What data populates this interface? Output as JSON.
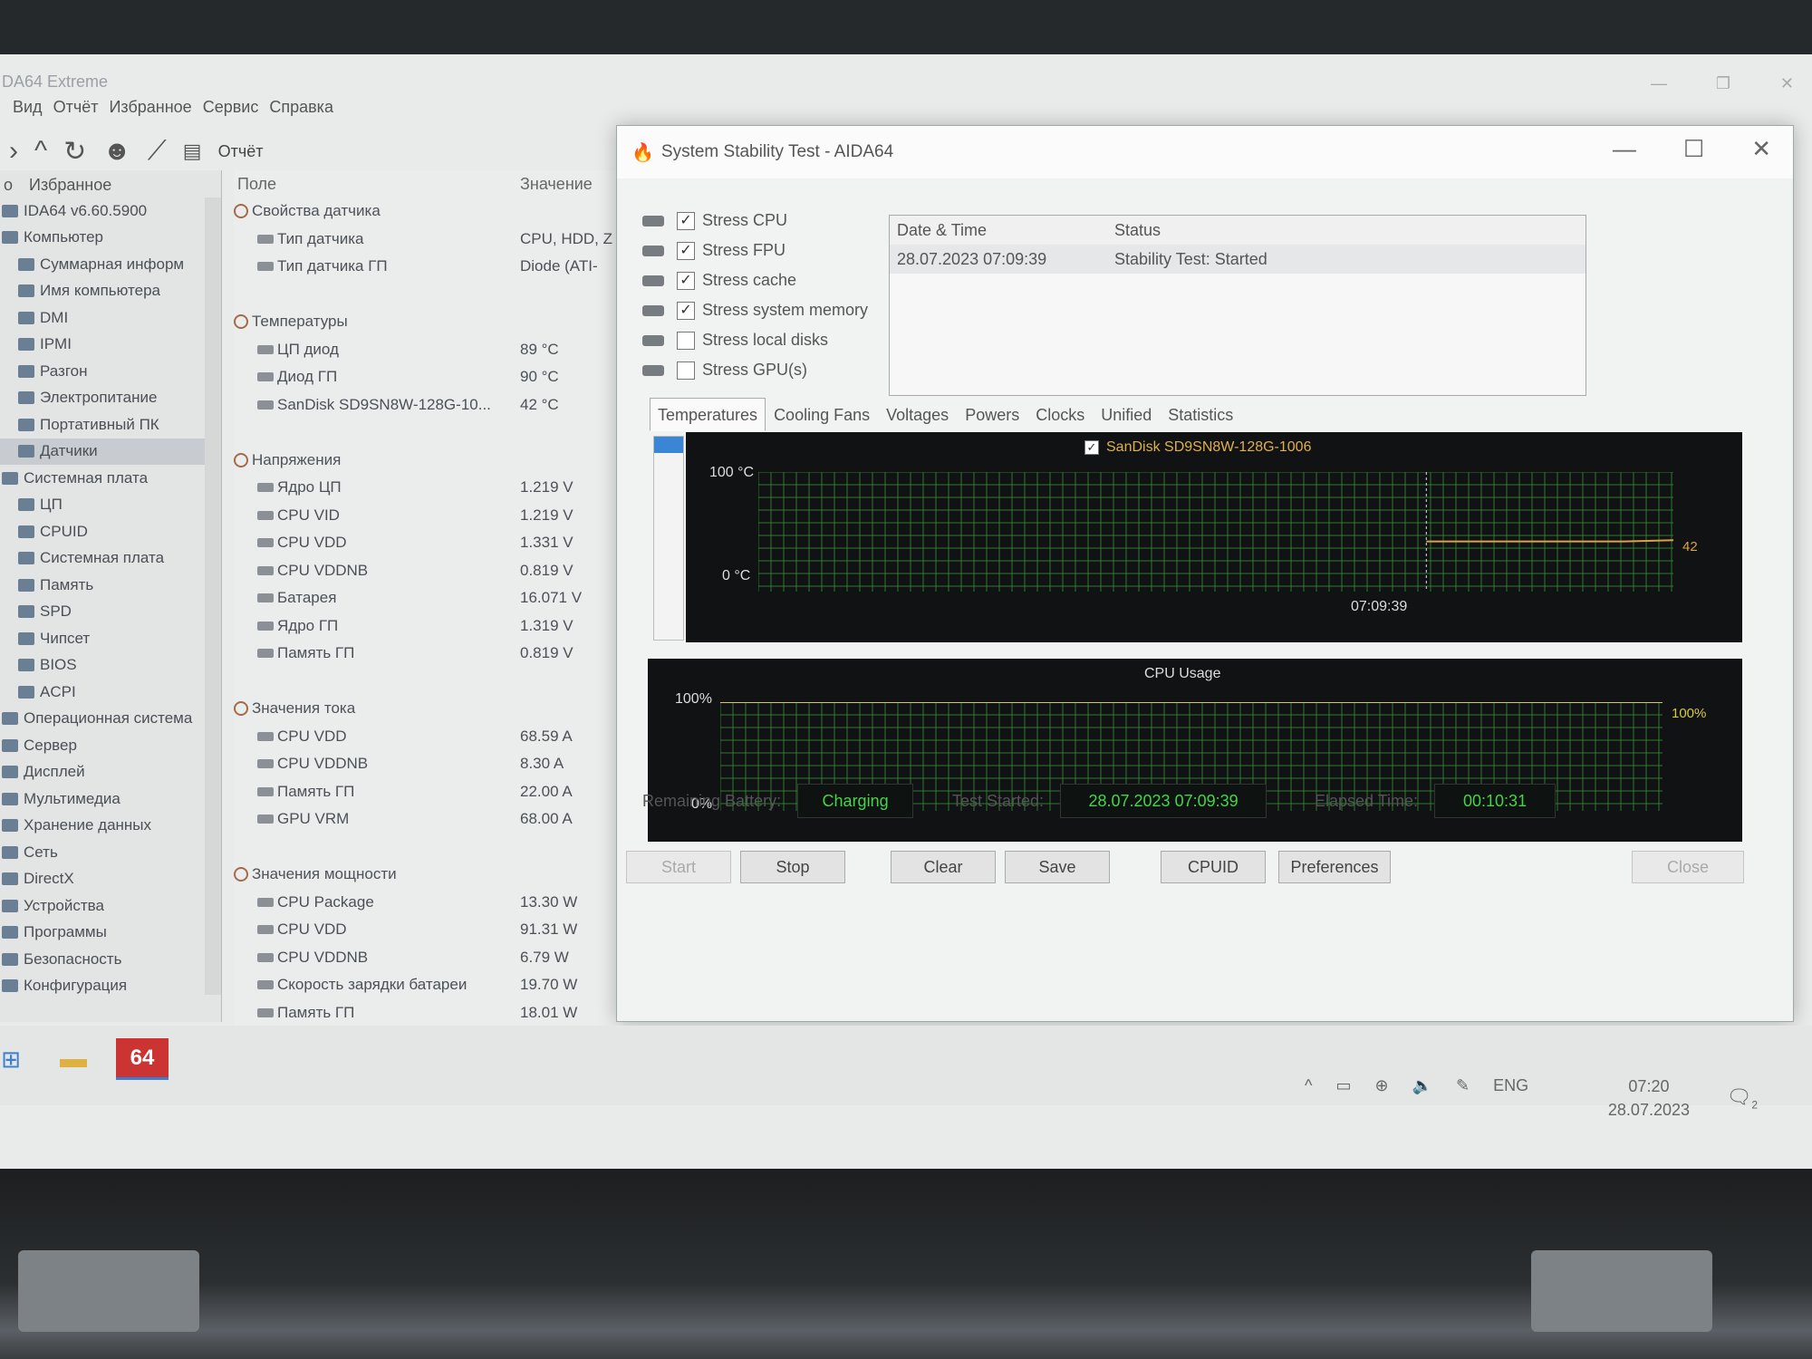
{
  "main": {
    "title": "DA64 Extreme",
    "menu": [
      "Вид",
      "Отчёт",
      "Избранное",
      "Сервис",
      "Справка"
    ],
    "toolbar_report": "Отчёт",
    "left_header": [
      "о",
      "Избранное"
    ],
    "tree": [
      "IDA64 v6.60.5900",
      "Компьютер",
      "Суммарная информ",
      "Имя компьютера",
      "DMI",
      "IPMI",
      "Разгон",
      "Электропитание",
      "Портативный ПК",
      "Датчики",
      "Системная плата",
      "ЦП",
      "CPUID",
      "Системная плата",
      "Память",
      "SPD",
      "Чипсет",
      "BIOS",
      "ACPI",
      "Операционная система",
      "Сервер",
      "Дисплей",
      "Мультимедиа",
      "Хранение данных",
      "Сеть",
      "DirectX",
      "Устройства",
      "Программы",
      "Безопасность",
      "Конфигурация"
    ],
    "columns": {
      "field": "Поле",
      "value": "Значение"
    },
    "rows": [
      {
        "field": "Свойства датчика",
        "value": "",
        "group": true
      },
      {
        "field": "Тип датчика",
        "value": "CPU, HDD, Z"
      },
      {
        "field": "Тип датчика ГП",
        "value": "Diode  (ATI-"
      },
      {
        "field": "",
        "value": "",
        "spacer": true
      },
      {
        "field": "Температуры",
        "value": "",
        "group": true
      },
      {
        "field": "ЦП диод",
        "value": "89 °C"
      },
      {
        "field": "Диод ГП",
        "value": "90 °C"
      },
      {
        "field": "SanDisk SD9SN8W-128G-10...",
        "value": "42 °C"
      },
      {
        "field": "",
        "value": "",
        "spacer": true
      },
      {
        "field": "Напряжения",
        "value": "",
        "group": true
      },
      {
        "field": "Ядро ЦП",
        "value": "1.219 V"
      },
      {
        "field": "CPU VID",
        "value": "1.219 V"
      },
      {
        "field": "CPU VDD",
        "value": "1.331 V"
      },
      {
        "field": "CPU VDDNB",
        "value": "0.819 V"
      },
      {
        "field": "Батарея",
        "value": "16.071 V"
      },
      {
        "field": "Ядро ГП",
        "value": "1.319 V"
      },
      {
        "field": "Память ГП",
        "value": "0.819 V"
      },
      {
        "field": "",
        "value": "",
        "spacer": true
      },
      {
        "field": "Значения тока",
        "value": "",
        "group": true
      },
      {
        "field": "CPU VDD",
        "value": "68.59 A"
      },
      {
        "field": "CPU VDDNB",
        "value": "8.30 A"
      },
      {
        "field": "Память ГП",
        "value": "22.00 A"
      },
      {
        "field": "GPU VRM",
        "value": "68.00 A"
      },
      {
        "field": "",
        "value": "",
        "spacer": true
      },
      {
        "field": "Значения мощности",
        "value": "",
        "group": true
      },
      {
        "field": "CPU Package",
        "value": "13.30 W"
      },
      {
        "field": "CPU VDD",
        "value": "91.31 W"
      },
      {
        "field": "CPU VDDNB",
        "value": "6.79 W"
      },
      {
        "field": "Скорость зарядки батареи",
        "value": "19.70 W"
      },
      {
        "field": "Память ГП",
        "value": "18.01 W"
      }
    ]
  },
  "taskbar": {
    "app_label": "64",
    "lang": "ENG",
    "time": "07:20",
    "date": "28.07.2023",
    "notif_count": "2"
  },
  "sst": {
    "title": "System Stability Test - AIDA64",
    "stress": [
      {
        "label": "Stress CPU",
        "checked": true
      },
      {
        "label": "Stress FPU",
        "checked": true
      },
      {
        "label": "Stress cache",
        "checked": true
      },
      {
        "label": "Stress system memory",
        "checked": true
      },
      {
        "label": "Stress local disks",
        "checked": false
      },
      {
        "label": "Stress GPU(s)",
        "checked": false
      }
    ],
    "log": {
      "headers": [
        "Date & Time",
        "Status"
      ],
      "rows": [
        [
          "28.07.2023 07:09:39",
          "Stability Test: Started"
        ]
      ]
    },
    "tabs": [
      "Temperatures",
      "Cooling Fans",
      "Voltages",
      "Powers",
      "Clocks",
      "Unified",
      "Statistics"
    ],
    "active_tab": "Temperatures",
    "temp_graph": {
      "legend": "SanDisk SD9SN8W-128G-1006",
      "y_top": "100 °C",
      "y_bottom": "0 °C",
      "marker_time": "07:09:39",
      "current": "42"
    },
    "cpu_graph": {
      "title": "CPU Usage",
      "y_top": "100%",
      "y_bottom": "0%",
      "current": "100%"
    },
    "remaining_battery_label": "Remaining Battery:",
    "remaining_battery": "Charging",
    "test_started_label": "Test Started:",
    "test_started": "28.07.2023 07:09:39",
    "elapsed_label": "Elapsed Time:",
    "elapsed": "00:10:31",
    "buttons": {
      "start": "Start",
      "stop": "Stop",
      "clear": "Clear",
      "save": "Save",
      "cpuid": "CPUID",
      "preferences": "Preferences",
      "close": "Close"
    }
  },
  "chart_data": [
    {
      "type": "line",
      "title": "SanDisk SD9SN8W-128G-1006",
      "ylabel": "°C",
      "ylim": [
        0,
        100
      ],
      "series": [
        {
          "name": "SanDisk SD9SN8W-128G-1006",
          "values": [
            42,
            42,
            42,
            42,
            42,
            43
          ]
        }
      ]
    },
    {
      "type": "line",
      "title": "CPU Usage",
      "ylim": [
        0,
        100
      ],
      "series": [
        {
          "values": [
            100,
            100,
            100,
            100,
            100,
            100
          ]
        }
      ]
    }
  ]
}
